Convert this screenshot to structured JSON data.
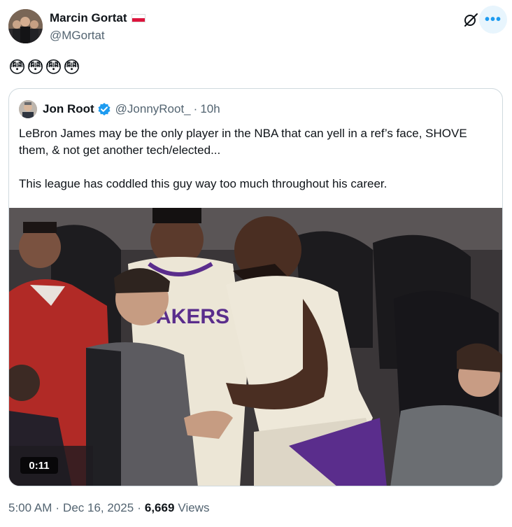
{
  "author": {
    "name": "Marcin Gortat",
    "handle": "@MGortat",
    "flag": "poland-flag-icon"
  },
  "tweet": {
    "text": "😳😳😳😳"
  },
  "quoted": {
    "name": "Jon Root",
    "handle": "@JonnyRoot_",
    "separator": "·",
    "time": "10h",
    "verified_color": "#1d9bf0",
    "paragraph_1": "LeBron James may be the only player in the NBA that can yell in a ref’s face, SHOVE them, & not get another tech/elected...",
    "paragraph_2": "This league has coddled this guy way too much throughout his career.",
    "video": {
      "duration": "0:11",
      "jersey_text": "AKERS"
    }
  },
  "meta": {
    "time": "5:00 AM",
    "dot1": "·",
    "date": "Dec 16, 2025",
    "dot2": "·",
    "views_count": "6,669",
    "views_label": "Views"
  },
  "actions": {
    "more": "•••"
  },
  "colors": {
    "accent": "#1d9bf0",
    "secondary_text": "#536471",
    "border": "#cfd9de"
  }
}
